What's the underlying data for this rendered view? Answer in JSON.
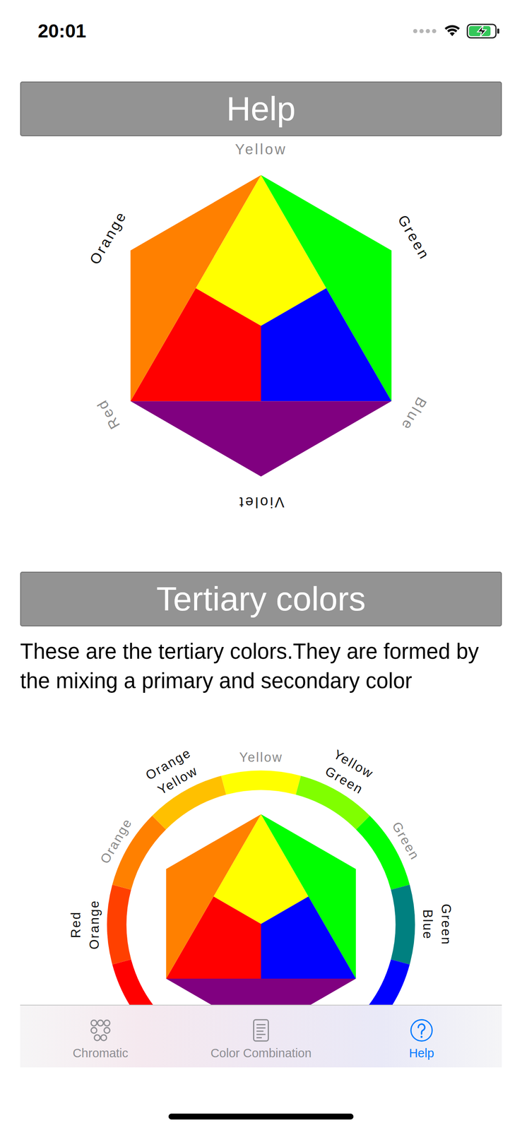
{
  "status_bar": {
    "time": "20:01",
    "signal": {
      "level": 0
    },
    "battery": {
      "level": 0.85,
      "charging": true
    }
  },
  "sections": [
    {
      "title": "Help"
    },
    {
      "title": "Tertiary colors",
      "text": "These are the tertiary colors.They are formed by the mixing a primary and secondary color"
    }
  ],
  "primary_wheel": {
    "labels": [
      {
        "label": "Yellow",
        "color": "#FFFF00",
        "muted": true
      },
      {
        "label": "Green",
        "color": "#00FF00",
        "muted": false
      },
      {
        "label": "Blue",
        "color": "#0000FF",
        "muted": true
      },
      {
        "label": "Violet",
        "color": "#800080",
        "muted": false
      },
      {
        "label": "Red",
        "color": "#FF0000",
        "muted": true
      },
      {
        "label": "Orange",
        "color": "#FF8000",
        "muted": false
      }
    ]
  },
  "tertiary_wheel": {
    "segments": [
      {
        "color": "#FF0000"
      },
      {
        "label": "Red Orange",
        "color": "#FF4000",
        "muted": false
      },
      {
        "label": "Orange",
        "color": "#FF8000",
        "muted": true
      },
      {
        "label": "Orange Yellow",
        "color": "#FFC000",
        "muted": false
      },
      {
        "label": "Yellow",
        "color": "#FFFF00",
        "muted": true
      },
      {
        "label": "Yellow Green",
        "color": "#80FF00",
        "muted": false
      },
      {
        "label": "Green",
        "color": "#00FF00",
        "muted": true
      },
      {
        "label": "Green Blue",
        "color": "#008080",
        "muted": false
      },
      {
        "color": "#0000FF"
      }
    ]
  },
  "tabs": [
    {
      "label": "Chromatic",
      "selected": false
    },
    {
      "label": "Color Combination",
      "selected": false
    },
    {
      "label": "Help",
      "selected": true
    }
  ]
}
